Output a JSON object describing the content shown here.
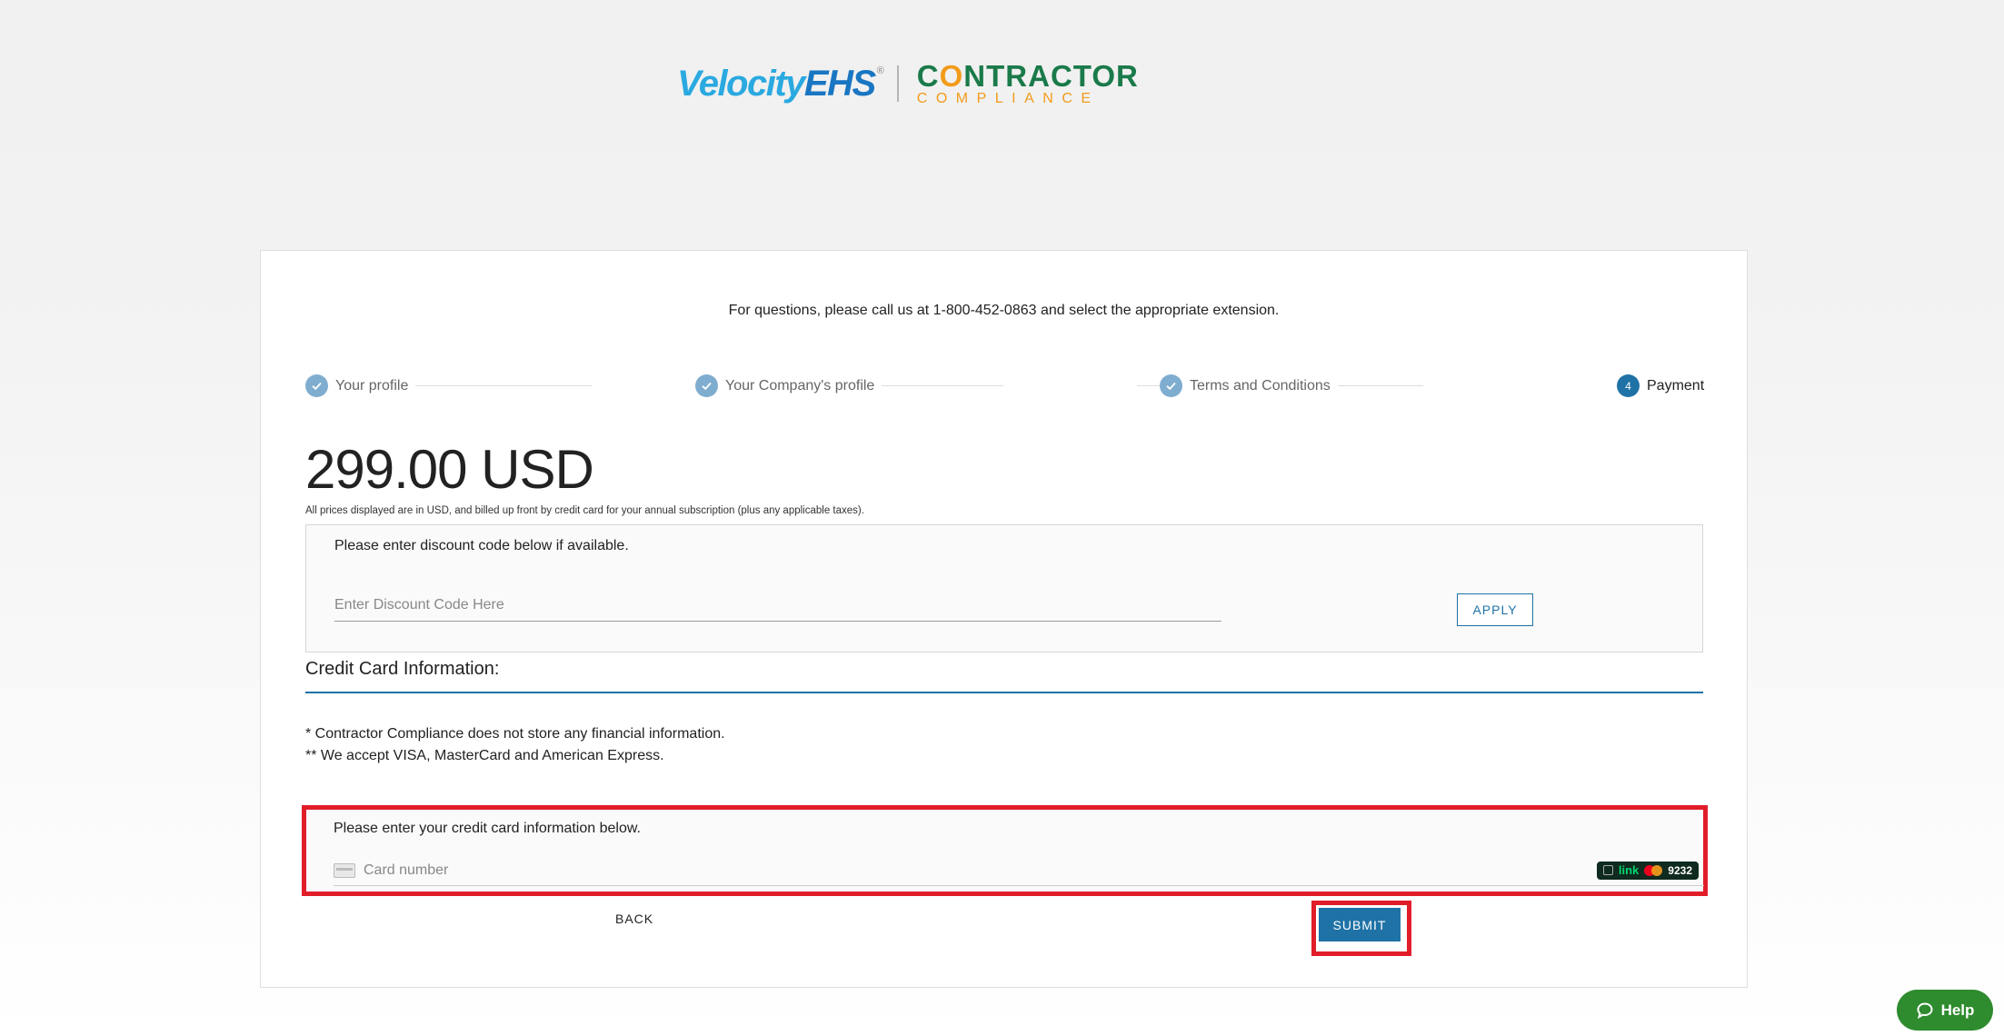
{
  "logo": {
    "velocity": "Velocity",
    "ehs": "EHS",
    "registered": "®",
    "contractor_prefix": "C",
    "contractor_o": "O",
    "contractor_rest": "NTRACTOR",
    "compliance": "COMPLIANCE"
  },
  "question_text": "For questions, please call us at 1-800-452-0863 and select the appropriate extension.",
  "steps": [
    {
      "label": "Your profile",
      "state": "done",
      "icon": "checkmark-icon"
    },
    {
      "label": "Your Company's profile",
      "state": "done",
      "icon": "checkmark-icon"
    },
    {
      "label": "Terms and Conditions",
      "state": "done",
      "icon": "checkmark-icon"
    },
    {
      "label": "Payment",
      "state": "active",
      "number": "4"
    }
  ],
  "price": "299.00 USD",
  "price_note": "All prices displayed are in USD, and billed up front by credit card for your annual subscription (plus any applicable taxes).",
  "discount": {
    "title": "Please enter discount code below if available.",
    "placeholder": "Enter Discount Code Here",
    "value": "",
    "apply_label": "APPLY"
  },
  "credit_card": {
    "heading": "Credit Card Information:",
    "note1": "* Contractor Compliance does not store any financial information.",
    "note2": "** We accept VISA, MasterCard and American Express.",
    "box_title": "Please enter your credit card information below.",
    "placeholder": "Card number",
    "value": "",
    "link_word": "link",
    "link_last4": "9232"
  },
  "actions": {
    "back_label": "BACK",
    "submit_label": "SUBMIT"
  },
  "help_label": "Help",
  "colors": {
    "primary": "#1f72a6",
    "step_done": "#7fadd0",
    "highlight": "#e11d2a",
    "help": "#2e8b2e"
  }
}
